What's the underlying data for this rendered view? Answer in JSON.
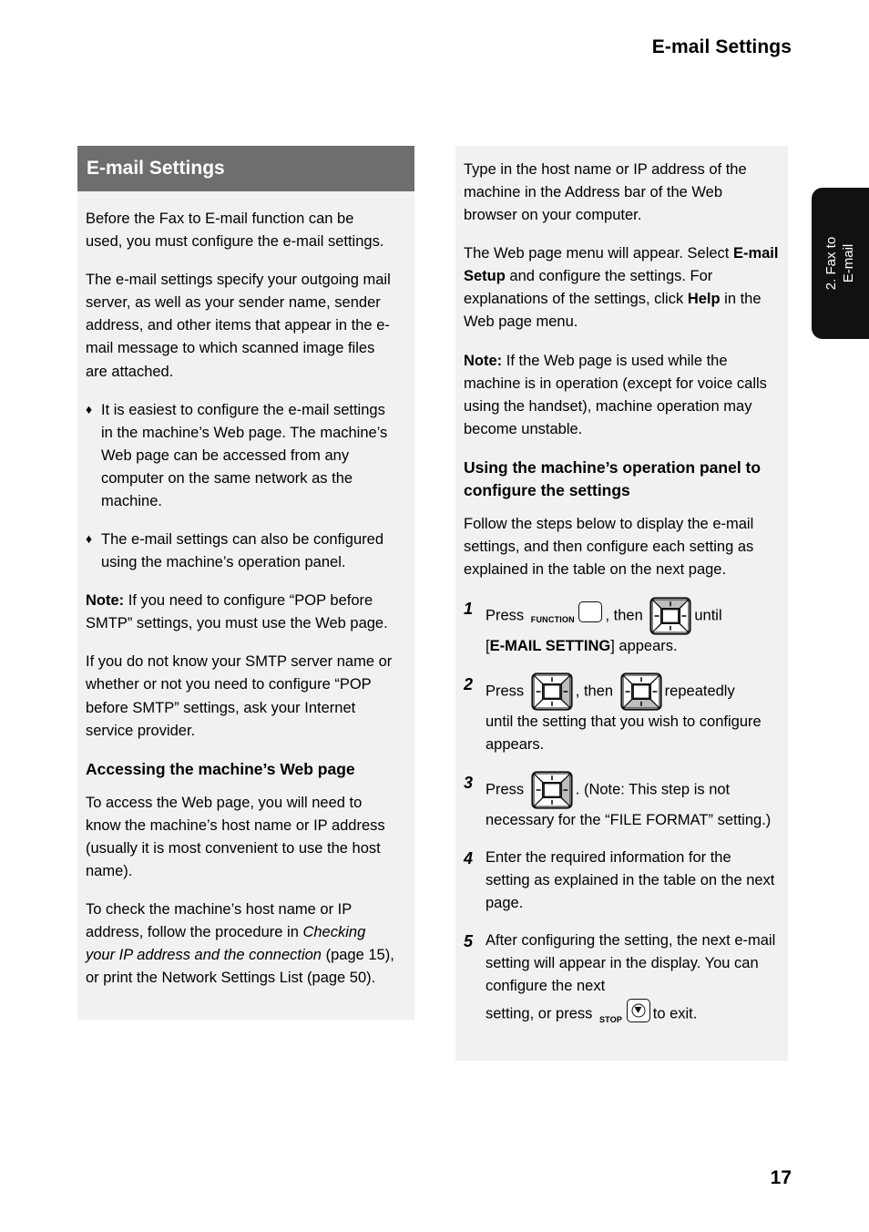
{
  "header": {
    "running_title": "E-mail Settings"
  },
  "side_tab": {
    "line1": "2. Fax to",
    "line2": "E-mail",
    "background_color": "#111111",
    "text_color": "#ffffff"
  },
  "left_column": {
    "section_title": "E-mail Settings",
    "section_bar_color": "#6e6e6e",
    "paragraph_1": "Before the Fax to E-mail function can be used, you must configure the e-mail settings.",
    "paragraph_2": "The e-mail settings specify your outgoing mail server, as well as your sender name, sender address, and other items that appear in the e-mail message to which scanned image files are attached.",
    "bullet_mark": "♦",
    "bullet_1": "It is easiest to configure the e-mail settings in the machine’s Web page. The machine’s Web page can be accessed from any computer on the same network as the machine.",
    "bullet_2": "The e-mail settings can also be configured using the machine’s operation panel.",
    "note_label": "Note:",
    "note_text": " If you need to configure “POP before SMTP” settings, you must use the Web page.",
    "paragraph_3": "If you do not know your SMTP server name or whether or not you need to configure “POP before SMTP” settings, ask your Internet service provider.",
    "subheading": "Accessing the machine’s Web page",
    "paragraph_4": "To access the Web page, you will need to know the machine’s host name or IP address (usually it is most convenient to use the host name).",
    "paragraph_5_part1": "To check the machine’s host name or IP address, follow the procedure in ",
    "paragraph_5_italic": "Checking your IP address and the connection",
    "paragraph_5_part2": " (page 15), or print the Network Settings List (page 50)."
  },
  "right_column": {
    "paragraph_1": "Type in the host name or IP address of the machine in the Address bar of the Web browser on your computer.",
    "paragraph_2_part1": "The Web page menu will appear. Select ",
    "paragraph_2_bold1": "E-mail Setup",
    "paragraph_2_part2": " and configure the settings. For explanations of the settings, click ",
    "paragraph_2_bold2": "Help",
    "paragraph_2_part3": " in the Web page menu.",
    "note_label": "Note:",
    "note_text": " If the Web page is used while the machine is in operation (except for voice calls using the handset), machine operation may become unstable.",
    "subheading": "Using the machine’s operation panel to configure the settings",
    "paragraph_3": "Follow the steps below to display the e-mail settings, and then configure each setting as explained in the table on the next page.",
    "steps": [
      {
        "number": "1",
        "text_before": "Press",
        "key1_caption": "FUNCTION",
        "key1_name": "function-key",
        "text_middle": ", then",
        "key2_name": "arrow-key-up",
        "key2_direction": "up",
        "text_after": "until",
        "line2_bracket_open": "[",
        "line2_bold": "E-MAIL SETTING",
        "line2_bracket_close": "] appears."
      },
      {
        "number": "2",
        "text_before": "Press",
        "key1_name": "arrow-key-right",
        "key1_direction": "right",
        "text_middle": ", then",
        "key2_name": "arrow-key-down",
        "key2_direction": "down",
        "text_after": "repeatedly",
        "line2": "until the setting that you wish to configure appears."
      },
      {
        "number": "3",
        "text_before": "Press",
        "key1_name": "arrow-key-right",
        "key1_direction": "right",
        "text_after": ". (Note: This step is not",
        "line2": "necessary for the “FILE FORMAT” setting.)"
      },
      {
        "number": "4",
        "text": "Enter the required information for the setting as explained in the table on the next page."
      },
      {
        "number": "5",
        "text_before": "After configuring the setting, the next e-mail setting will appear in the display. You can configure the next",
        "line2_before": "setting, or press",
        "stop_caption": "STOP",
        "stop_key_name": "stop-key",
        "line2_after": "to exit."
      }
    ]
  },
  "footer": {
    "page_number": "17"
  }
}
